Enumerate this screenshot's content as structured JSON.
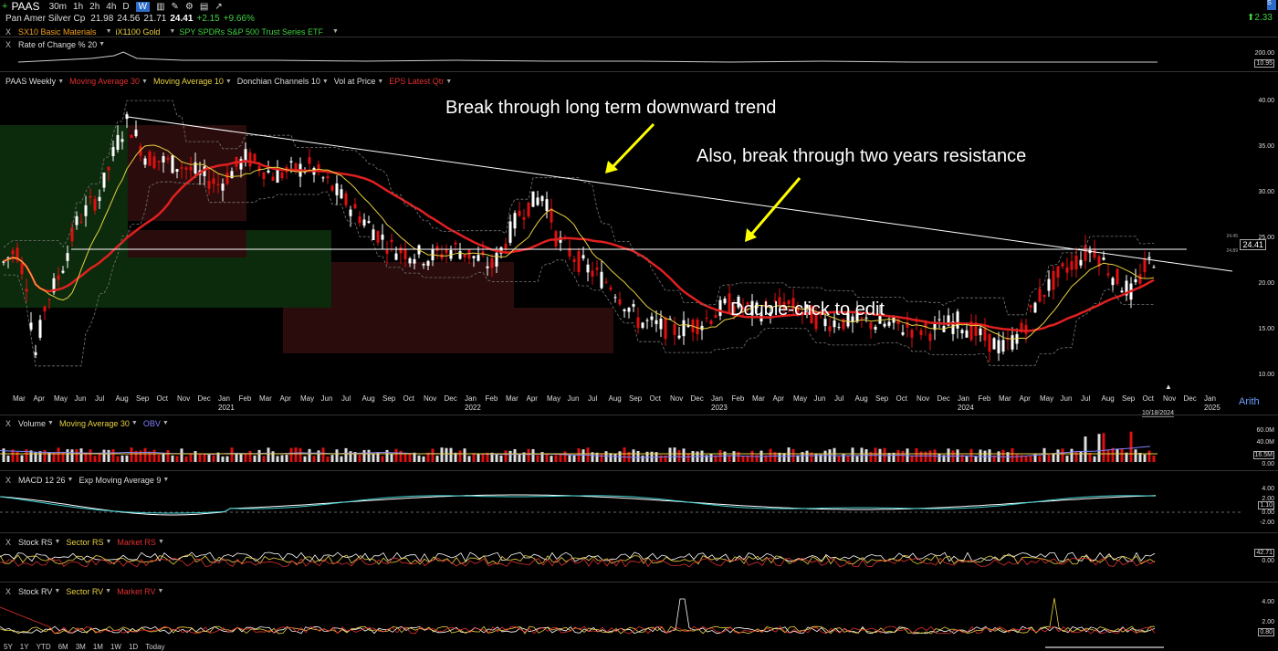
{
  "toolbar": {
    "symbol": "PAAS",
    "intervals": [
      "30m",
      "1h",
      "2h",
      "4h",
      "D",
      "W"
    ],
    "active_interval": "W"
  },
  "quote": {
    "name": "Pan Amer Silver Cp",
    "open": "21.98",
    "high": "24.56",
    "low": "21.71",
    "close": "24.41",
    "change": "+2.15",
    "change_pct": "+9.66%",
    "right_change": "2.33"
  },
  "compare_row": {
    "items": [
      {
        "label": "SX10 Basic Materials",
        "color": "#f0a020"
      },
      {
        "label": "iX1100 Gold",
        "color": "#e8d040"
      },
      {
        "label": "SPY SPDRs S&P 500 Trust Series ETF",
        "color": "#40d040"
      }
    ]
  },
  "roc_panel": {
    "title": "Rate of Change % 20",
    "ticks": [
      "200.00",
      "10.95"
    ]
  },
  "main_panel": {
    "overlays": [
      {
        "label": "PAAS Weekly",
        "color": "#ddd"
      },
      {
        "label": "Moving Average 30",
        "color": "#e03030"
      },
      {
        "label": "Moving Average 10",
        "color": "#e8d040"
      },
      {
        "label": "Donchian Channels 10",
        "color": "#ddd"
      },
      {
        "label": "Vol at Price",
        "color": "#ddd"
      },
      {
        "label": "EPS Latest Qtr",
        "color": "#e03030"
      }
    ],
    "price_ticks": [
      "40.00",
      "35.00",
      "30.00",
      "25.00",
      "20.00",
      "15.00",
      "10.00"
    ],
    "price_tag": "24.41",
    "small_tags": [
      "24.45",
      "24.89"
    ],
    "scale_mode": "Arith",
    "date_label": "10/18/2024",
    "months": [
      "Mar",
      "Apr",
      "May",
      "Jun",
      "Jul",
      "Aug",
      "Sep",
      "Oct",
      "Nov",
      "Dec",
      "Jan",
      "Feb",
      "Mar",
      "Apr",
      "May",
      "Jun",
      "Jul",
      "Aug",
      "Sep",
      "Oct",
      "Nov",
      "Dec",
      "Jan",
      "Feb",
      "Mar",
      "Apr",
      "May",
      "Jun",
      "Jul",
      "Aug",
      "Sep",
      "Oct",
      "Nov",
      "Dec",
      "Jan",
      "Feb",
      "Mar",
      "Apr",
      "May",
      "Jun",
      "Jul",
      "Aug",
      "Sep",
      "Oct",
      "Nov",
      "Dec",
      "Jan",
      "Feb",
      "Mar",
      "Apr",
      "May",
      "Jun",
      "Jul",
      "Aug",
      "Sep",
      "Oct",
      "Nov",
      "Dec",
      "Jan"
    ],
    "years": [
      "2021",
      "2022",
      "2023",
      "2024",
      "2025"
    ],
    "annotations": {
      "trend": "Break through long term downward trend",
      "resistance": "Also, break through two years resistance",
      "edit_hint": "Double-click to edit"
    }
  },
  "volume_panel": {
    "overlays": [
      {
        "label": "Volume",
        "color": "#ddd"
      },
      {
        "label": "Moving Average 30",
        "color": "#e8d040"
      },
      {
        "label": "OBV",
        "color": "#8080ff"
      }
    ],
    "ticks": [
      "60.0M",
      "40.0M",
      "16.5M",
      "0.00"
    ]
  },
  "macd_panel": {
    "overlays": [
      {
        "label": "MACD 12 26",
        "color": "#ddd"
      },
      {
        "label": "Exp Moving Average 9",
        "color": "#ddd"
      }
    ],
    "ticks": [
      "4.00",
      "2.00",
      "1.10",
      "0.00",
      "-2.00"
    ]
  },
  "rs_panel": {
    "overlays": [
      {
        "label": "Stock RS",
        "color": "#ddd"
      },
      {
        "label": "Sector RS",
        "color": "#e8d040"
      },
      {
        "label": "Market RS",
        "color": "#e03030"
      }
    ],
    "ticks": [
      "42.71",
      "0.00"
    ]
  },
  "rv_panel": {
    "overlays": [
      {
        "label": "Stock RV",
        "color": "#ddd"
      },
      {
        "label": "Sector RV",
        "color": "#e8d040"
      },
      {
        "label": "Market RV",
        "color": "#e03030"
      }
    ],
    "ticks": [
      "4.00",
      "2.00",
      "0.80"
    ]
  },
  "range_buttons": [
    "5Y",
    "1Y",
    "YTD",
    "6M",
    "3M",
    "1M",
    "1W",
    "1D",
    "Today"
  ],
  "colors": {
    "up": "#ffffff",
    "down": "#e01010",
    "ma30": "#e02020",
    "ma10": "#e8d040",
    "green_zone": "#0c2a0c",
    "red_zone": "#2a0c0c"
  }
}
